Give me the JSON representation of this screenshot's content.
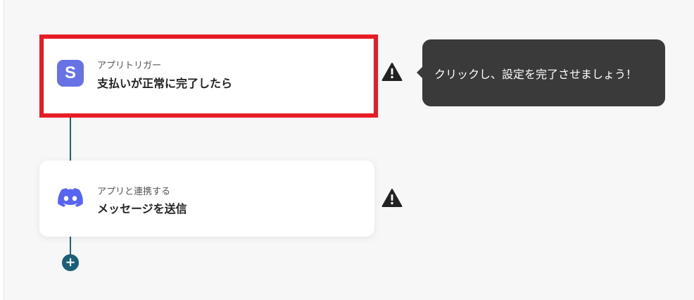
{
  "trigger": {
    "sub_label": "アプリトリガー",
    "title": "支払いが正常に完了したら",
    "app_icon": "stripe-icon",
    "app_letter": "S",
    "icon_color": "#6772e5",
    "warning_icon": "warning-icon"
  },
  "action": {
    "sub_label": "アプリと連携する",
    "title": "メッセージを送信",
    "app_icon": "discord-icon",
    "icon_color": "#5865f2",
    "warning_icon": "warning-icon"
  },
  "tooltip": {
    "text": "クリックし、設定を完了させましょう！"
  },
  "add_button": {
    "symbol": "+"
  },
  "colors": {
    "highlight": "#e81c24",
    "connector": "#1f5f78",
    "tooltip_bg": "#3a3a3a"
  }
}
